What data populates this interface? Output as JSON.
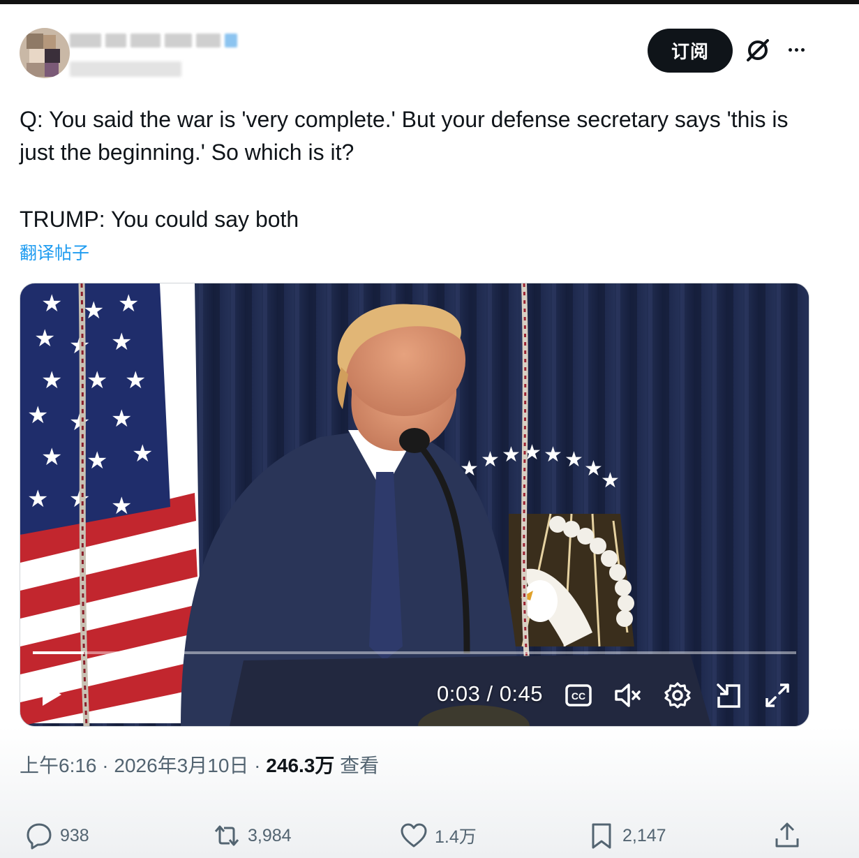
{
  "post": {
    "subscribe_label": "订阅",
    "text_line1": "Q: You said the war is 'very complete.' But your defense secretary says 'this is just the beginning.' So which is it?",
    "text_line2": "TRUMP: You could say both",
    "translate_label": "翻译帖子"
  },
  "video": {
    "time_current": "0:03",
    "time_total": "0:45",
    "progress_fraction": 0.067,
    "icons": [
      "play-icon",
      "closed-captions-icon",
      "volume-muted-icon",
      "settings-icon",
      "picture-in-picture-icon",
      "fullscreen-icon"
    ]
  },
  "meta": {
    "time": "上午6:16",
    "date": "2026年3月10日",
    "views_count": "246.3万",
    "views_label": "查看"
  },
  "actions": {
    "replies": "938",
    "reposts": "3,984",
    "likes": "1.4万",
    "bookmarks": "2,147"
  },
  "colors": {
    "link": "#1d9bf0",
    "text": "#0f1419",
    "muted": "#536471"
  }
}
